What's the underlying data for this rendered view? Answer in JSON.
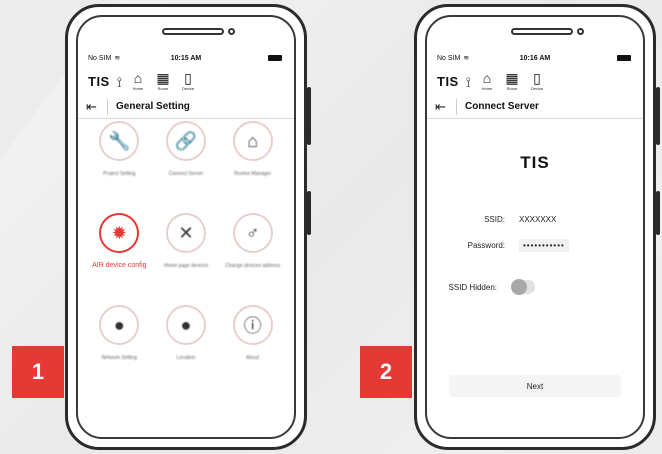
{
  "colors": {
    "accent": "#e53935",
    "badge": "#e53935"
  },
  "steps": {
    "one": "1",
    "two": "2"
  },
  "left_phone": {
    "status": {
      "carrier": "No SIM",
      "wifi_icon": "wifi-icon",
      "time": "10:15 AM"
    },
    "topbar": {
      "logo": "TIS",
      "nav": [
        {
          "icon": "home-icon",
          "label": "Home"
        },
        {
          "icon": "room-icon",
          "label": "Room"
        },
        {
          "icon": "device-icon",
          "label": "Device"
        }
      ]
    },
    "title": "General Setting",
    "tiles": [
      {
        "icon": "wrench-icon",
        "label": "Project Setting"
      },
      {
        "icon": "link-icon",
        "label": "Connect Server"
      },
      {
        "icon": "rooms-icon",
        "label": "Rooms Manager"
      },
      {
        "icon": "air-gear-icon",
        "label": "AIR device config",
        "active": true
      },
      {
        "icon": "tools-icon",
        "label": "Home page devices"
      },
      {
        "icon": "key-icon",
        "label": "Change devices address"
      },
      {
        "icon": "globe-icon",
        "label": "Network Setting"
      },
      {
        "icon": "location-icon",
        "label": "Location"
      },
      {
        "icon": "info-icon",
        "label": "About"
      }
    ]
  },
  "right_phone": {
    "status": {
      "carrier": "No SIM",
      "wifi_icon": "wifi-icon",
      "time": "10:16 AM"
    },
    "topbar": {
      "logo": "TIS",
      "nav": [
        {
          "icon": "home-icon",
          "label": "Home"
        },
        {
          "icon": "room-icon",
          "label": "Room"
        },
        {
          "icon": "device-icon",
          "label": "Device"
        }
      ]
    },
    "title": "Connect Server",
    "brand": "TIS",
    "form": {
      "ssid_label": "SSID:",
      "ssid_value": "XXXXXXX",
      "password_label": "Password:",
      "password_value": "•••••••••••",
      "hidden_label": "SSID Hidden:",
      "hidden_on": false
    },
    "next_label": "Next"
  }
}
